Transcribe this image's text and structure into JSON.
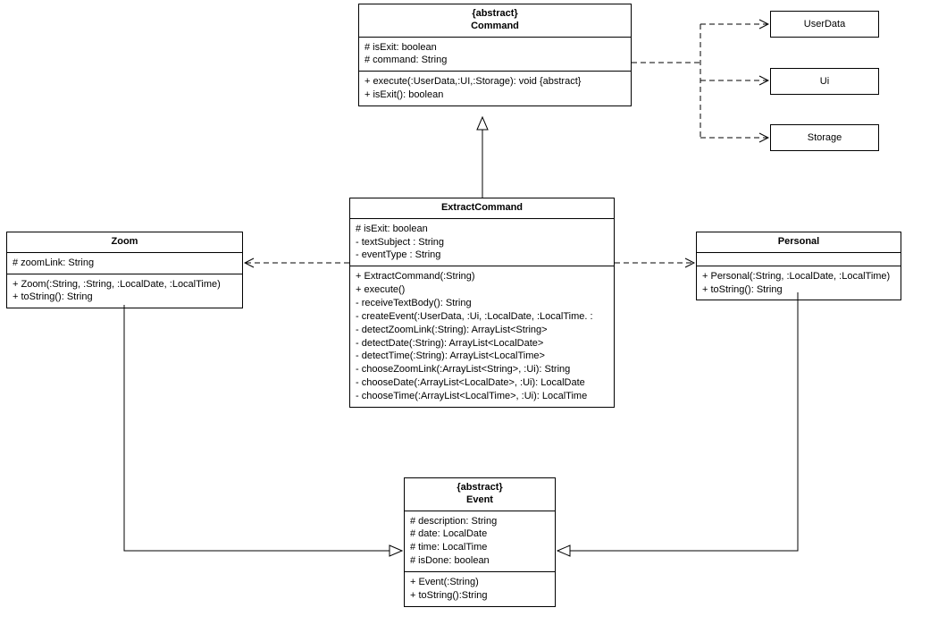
{
  "classes": {
    "command": {
      "stereo": "{abstract}",
      "name": "Command",
      "attrs": [
        "# isExit: boolean",
        "# command: String"
      ],
      "ops": [
        "+ execute(:UserData,:UI,:Storage): void {abstract}",
        "+ isExit(): boolean"
      ]
    },
    "userdata": "UserData",
    "ui": "Ui",
    "storage": "Storage",
    "extract": {
      "name": "ExtractCommand",
      "attrs": [
        "# isExit: boolean",
        "- textSubject : String",
        "- eventType : String"
      ],
      "ops": [
        "+ ExtractCommand(:String)",
        "+ execute()",
        "- receiveTextBody(): String",
        "- createEvent(:UserData, :Ui, :LocalDate, :LocalTime. :",
        "- detectZoomLink(:String): ArrayList<String>",
        "- detectDate(:String): ArrayList<LocalDate>",
        "- detectTime(:String): ArrayList<LocalTime>",
        "- chooseZoomLink(:ArrayList<String>, :Ui): String",
        "- chooseDate(:ArrayList<LocalDate>, :Ui): LocalDate",
        "- chooseTime(:ArrayList<LocalTime>, :Ui): LocalTime"
      ]
    },
    "zoom": {
      "name": "Zoom",
      "attrs": [
        "# zoomLink: String"
      ],
      "ops": [
        "+ Zoom(:String, :String, :LocalDate, :LocalTime)",
        "+ toString(): String"
      ]
    },
    "personal": {
      "name": "Personal",
      "attrs": [],
      "ops": [
        "+ Personal(:String, :LocalDate, :LocalTime)",
        "+ toString(): String"
      ]
    },
    "event": {
      "stereo": "{abstract}",
      "name": "Event",
      "attrs": [
        "# description: String",
        "# date: LocalDate",
        "# time: LocalTime",
        "# isDone: boolean"
      ],
      "ops": [
        "+ Event(:String)",
        "+ toString():String"
      ]
    }
  }
}
